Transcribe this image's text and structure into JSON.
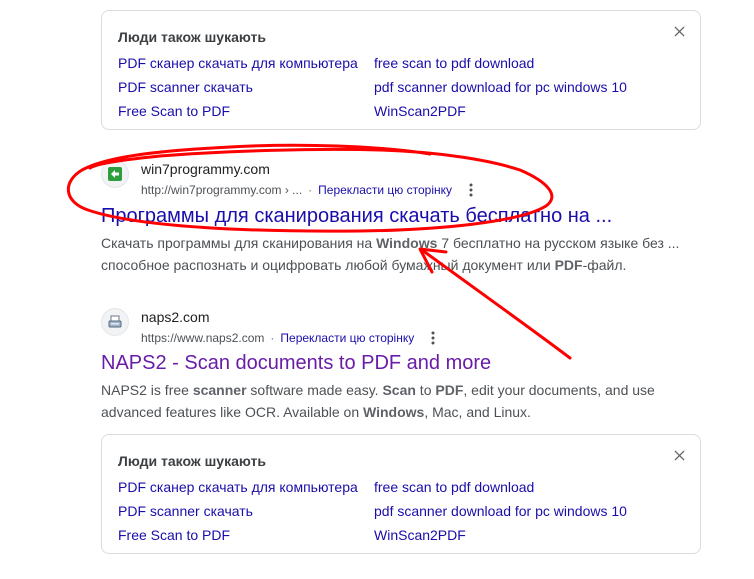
{
  "people_also_search_top": {
    "title": "Люди також шукають",
    "links": [
      "PDF сканер скачать для компьютера",
      "free scan to pdf download",
      "PDF scanner скачать",
      "pdf scanner download for pc windows 10",
      "Free Scan to PDF",
      "WinScan2PDF"
    ]
  },
  "result_1": {
    "site_name": "win7programmy.com",
    "url": "http://win7programmy.com › ...",
    "translate": "Перекласти цю сторінку",
    "title": "Программы для сканирования скачать бесплатно на ...",
    "snippet_parts": {
      "a": "Скачать программы для сканирования на ",
      "b_bold": "Windows",
      "c": " 7 бесплатно на русском языке без ...",
      "d": "способное распознать и оцифровать любой бумажный документ или ",
      "e_bold": "PDF",
      "f": "-файл."
    }
  },
  "result_2": {
    "site_name": "naps2.com",
    "url": "https://www.naps2.com",
    "translate": "Перекласти цю сторінку",
    "title": "NAPS2 - Scan documents to PDF and more",
    "snippet_parts": {
      "a": "NAPS2 is free ",
      "b_bold": "scanner",
      "c": " software made easy. ",
      "d_bold": "Scan",
      "e": " to ",
      "f_bold": "PDF",
      "g": ", edit your documents, and use",
      "h": "advanced features like OCR. Available on ",
      "i_bold": "Windows",
      "j": ", Mac, and Linux."
    }
  },
  "people_also_search_bottom": {
    "title": "Люди також шукають",
    "links": [
      "PDF сканер скачать для компьютера",
      "free scan to pdf download",
      "PDF scanner скачать",
      "pdf scanner download for pc windows 10",
      "Free Scan to PDF",
      "WinScan2PDF"
    ]
  },
  "colors": {
    "link": "#1a0dab",
    "visited": "#681da8",
    "annotation": "#ff0000"
  },
  "icons": {
    "favicon_1": "green-arrow-favicon-icon",
    "favicon_2": "scanner-favicon-icon"
  }
}
